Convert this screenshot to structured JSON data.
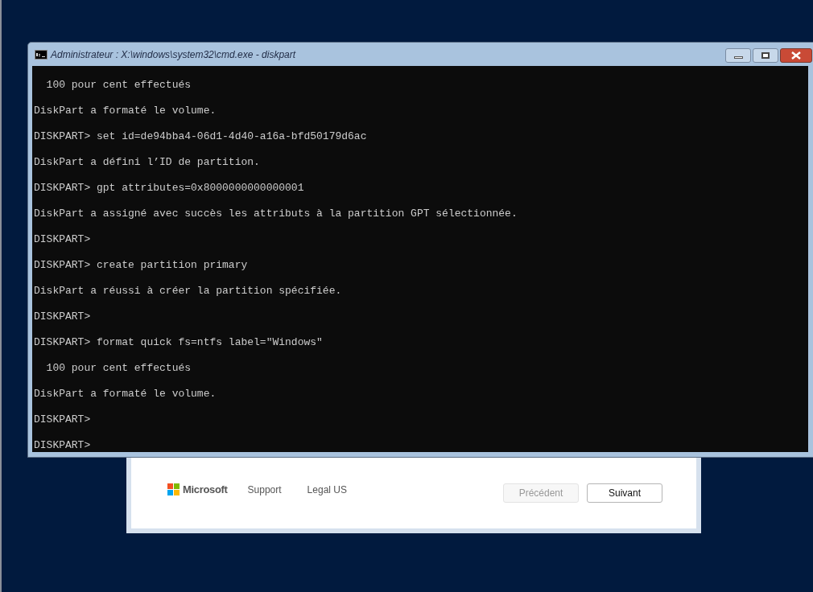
{
  "console_window": {
    "title": "Administrateur : X:\\windows\\system32\\cmd.exe - diskpart",
    "lines": [
      "  100 pour cent effectués",
      "DiskPart a formaté le volume.",
      "DISKPART> set id=de94bba4-06d1-4d40-a16a-bfd50179d6ac",
      "DiskPart a défini l’ID de partition.",
      "DISKPART> gpt attributes=0x8000000000000001",
      "DiskPart a assigné avec succès les attributs à la partition GPT sélectionnée.",
      "DISKPART>",
      "DISKPART> create partition primary",
      "DiskPart a réussi à créer la partition spécifiée.",
      "DISKPART>",
      "DISKPART> format quick fs=ntfs label=\"Windows\"",
      "  100 pour cent effectués",
      "DiskPart a formaté le volume.",
      "DISKPART>",
      "DISKPART>"
    ]
  },
  "setup_footer": {
    "brand": "Microsoft",
    "links": [
      "Support",
      "Legal US"
    ],
    "buttons": [
      {
        "label": "Précédent",
        "disabled": true
      },
      {
        "label": "Suivant",
        "disabled": false
      }
    ]
  }
}
